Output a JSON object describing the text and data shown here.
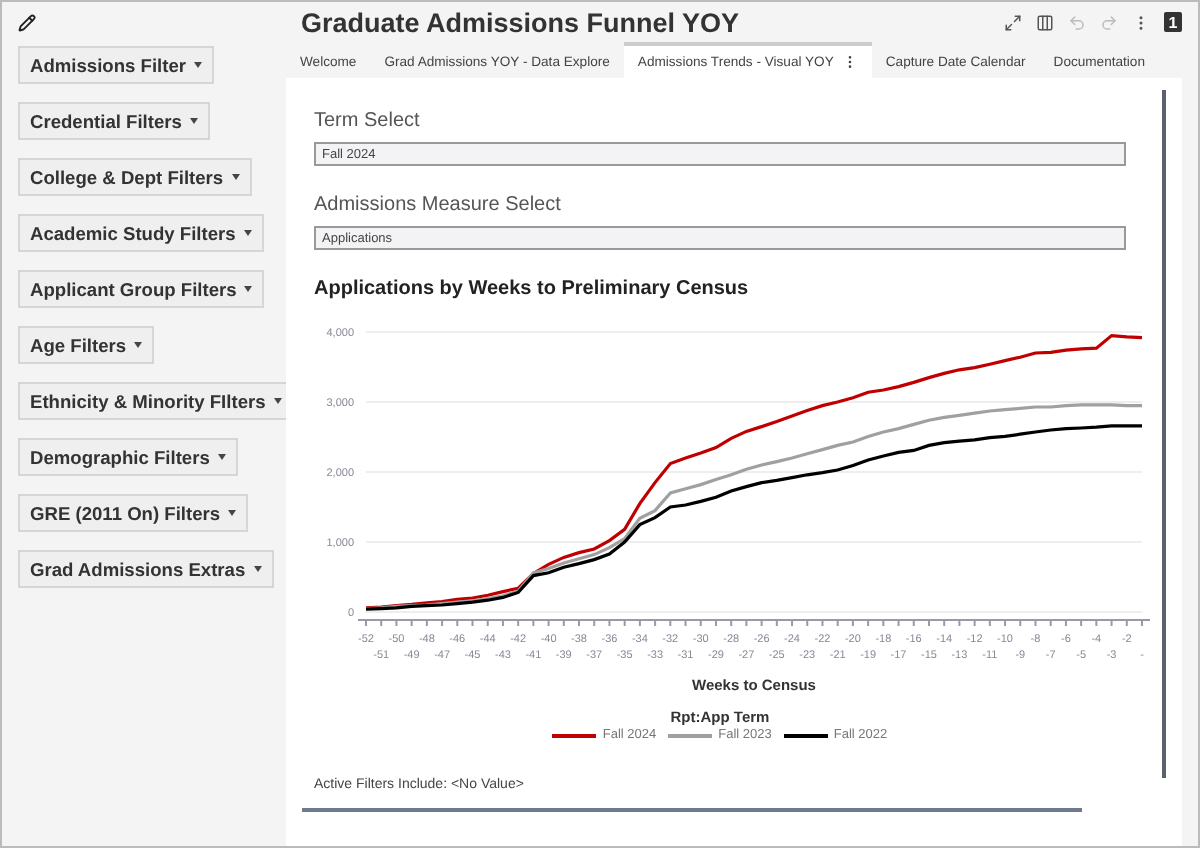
{
  "window": {
    "title": "Graduate Admissions Funnel YOY"
  },
  "toolbar": {
    "undo": {
      "disabled": true
    },
    "redo": {
      "disabled": true
    },
    "badge": "1"
  },
  "sidebar": {
    "filters": [
      "Admissions Filter",
      "Credential Filters",
      "College & Dept Filters",
      "Academic Study Filters",
      "Applicant Group Filters",
      "Age Filters",
      "Ethnicity & Minority FIlters",
      "Demographic Filters",
      "GRE (2011 On) Filters",
      "Grad Admissions Extras"
    ]
  },
  "tabs": [
    {
      "label": "Welcome",
      "selected": false
    },
    {
      "label": "Grad Admissions YOY - Data Explore",
      "selected": false
    },
    {
      "label": "Admissions Trends - Visual YOY",
      "selected": true
    },
    {
      "label": "Capture Date Calendar",
      "selected": false
    },
    {
      "label": "Documentation",
      "selected": false
    }
  ],
  "term_select": {
    "label": "Term Select",
    "value": "Fall 2024"
  },
  "measure_select": {
    "label": "Admissions Measure Select",
    "value": "Applications"
  },
  "chart": {
    "chart_data": {
      "type": "line",
      "title": "Applications by Weeks to Preliminary Census",
      "xlabel": "Weeks to Census",
      "legend_title": "Rpt:App Term",
      "categories": [
        "-52",
        "-51",
        "-50",
        "-49",
        "-48",
        "-47",
        "-46",
        "-45",
        "-44",
        "-43",
        "-42",
        "-41",
        "-40",
        "-39",
        "-38",
        "-37",
        "-36",
        "-35",
        "-34",
        "-33",
        "-32",
        "-31",
        "-30",
        "-29",
        "-28",
        "-27",
        "-26",
        "-25",
        "-24",
        "-23",
        "-22",
        "-21",
        "-20",
        "-19",
        "-18",
        "-17",
        "-16",
        "-15",
        "-14",
        "-13",
        "-12",
        "-11",
        "-10",
        "-9",
        "-8",
        "-7",
        "-6",
        "-5",
        "-4",
        "-3",
        "-2",
        "-"
      ],
      "ylim": [
        0,
        4000
      ],
      "grid": true,
      "yticks": [
        {
          "value": 0,
          "label": "0"
        },
        {
          "value": 1000,
          "label": "1,000"
        },
        {
          "value": 2000,
          "label": "2,000"
        },
        {
          "value": 3000,
          "label": "3,000"
        },
        {
          "value": 4000,
          "label": "4,000"
        }
      ],
      "series": [
        {
          "name": "Fall 2024",
          "color": "#c00000",
          "values": [
            60,
            70,
            90,
            110,
            130,
            150,
            180,
            200,
            240,
            290,
            340,
            550,
            680,
            780,
            850,
            900,
            1020,
            1180,
            1550,
            1850,
            2120,
            2200,
            2270,
            2350,
            2480,
            2580,
            2650,
            2720,
            2800,
            2880,
            2950,
            3000,
            3060,
            3140,
            3170,
            3220,
            3280,
            3350,
            3410,
            3460,
            3490,
            3540,
            3590,
            3640,
            3700,
            3710,
            3740,
            3760,
            3770,
            3950,
            3930,
            3920
          ]
        },
        {
          "name": "Fall 2023",
          "color": "#a0a0a0",
          "values": [
            50,
            60,
            80,
            90,
            100,
            120,
            140,
            160,
            190,
            230,
            300,
            560,
            620,
            700,
            760,
            820,
            920,
            1050,
            1340,
            1450,
            1700,
            1760,
            1820,
            1890,
            1960,
            2040,
            2100,
            2150,
            2200,
            2260,
            2320,
            2380,
            2430,
            2510,
            2570,
            2620,
            2680,
            2740,
            2780,
            2810,
            2840,
            2870,
            2890,
            2910,
            2930,
            2930,
            2950,
            2960,
            2960,
            2960,
            2950,
            2950
          ]
        },
        {
          "name": "Fall 2022",
          "color": "#000000",
          "values": [
            40,
            50,
            60,
            80,
            90,
            100,
            120,
            140,
            170,
            210,
            280,
            520,
            560,
            640,
            690,
            750,
            830,
            1000,
            1250,
            1350,
            1500,
            1530,
            1580,
            1640,
            1730,
            1790,
            1850,
            1880,
            1920,
            1960,
            1990,
            2030,
            2090,
            2170,
            2230,
            2280,
            2310,
            2380,
            2420,
            2440,
            2460,
            2490,
            2510,
            2540,
            2570,
            2600,
            2620,
            2630,
            2640,
            2660,
            2660,
            2660
          ]
        }
      ]
    }
  },
  "active_filters": "Active Filters Include: <No Value>"
}
